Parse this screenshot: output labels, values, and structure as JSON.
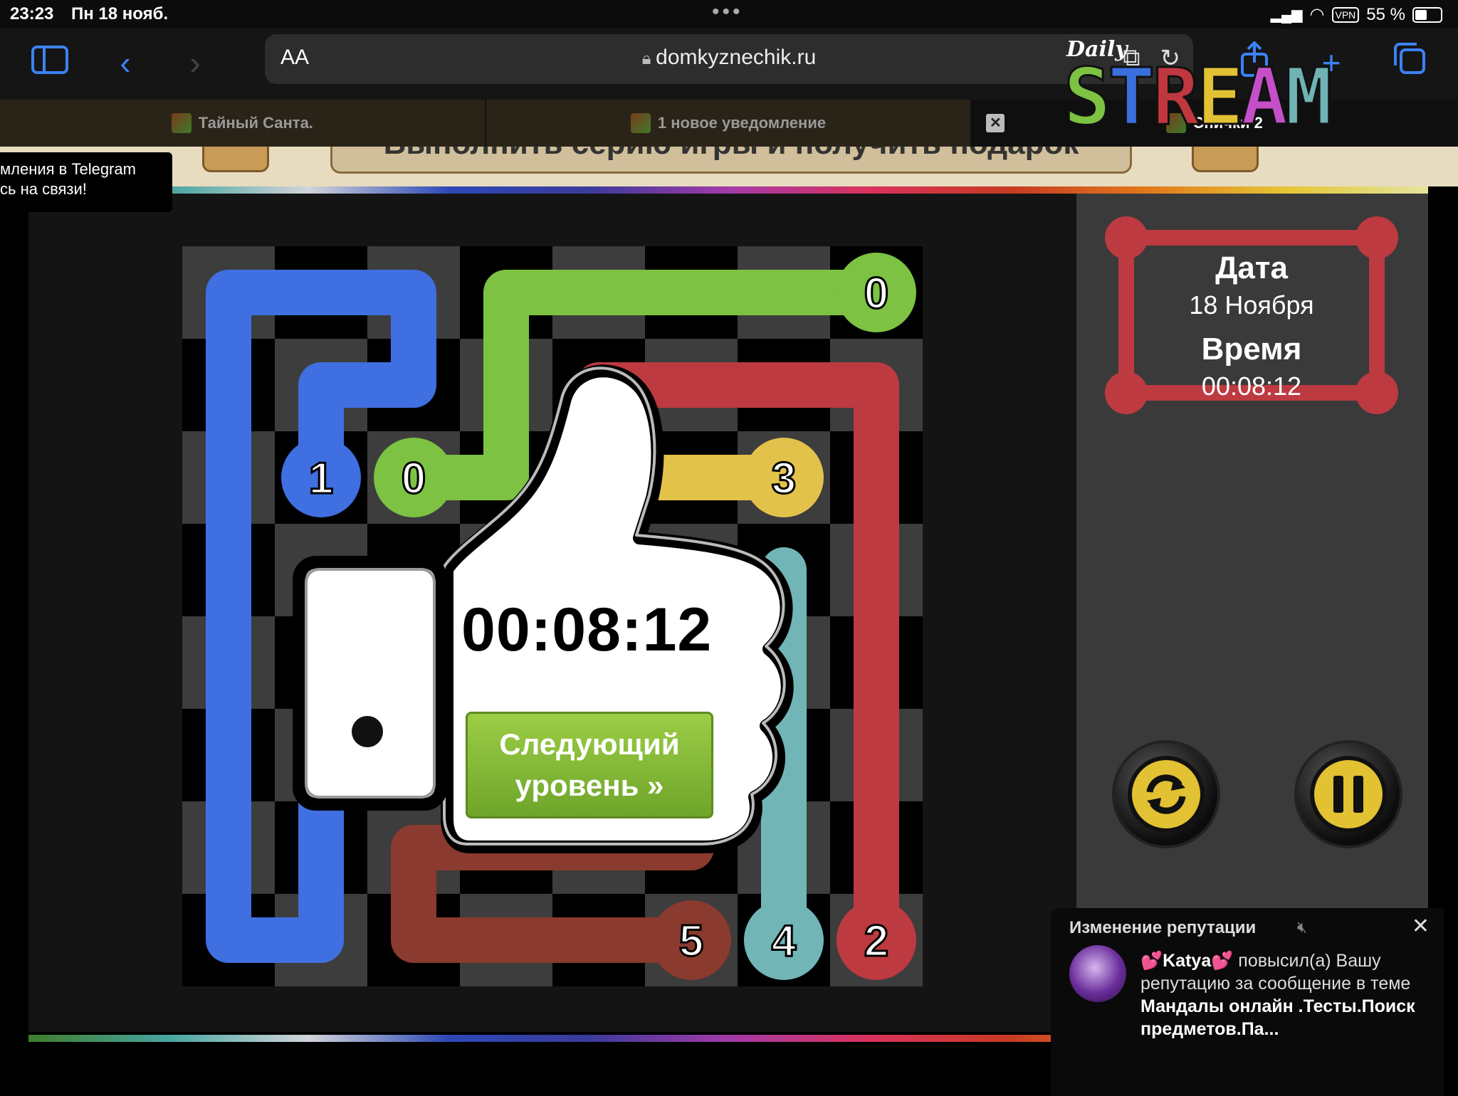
{
  "status_bar": {
    "time": "23:23",
    "date": "Пн 18 нояб.",
    "dots": "•••",
    "vpn": "VPN",
    "battery": "55 %"
  },
  "toolbar": {
    "aa_label": "AA",
    "url": "domkyznechik.ru"
  },
  "tabs": [
    {
      "label": "Тайный Санта.",
      "active": false
    },
    {
      "label": "1 новое уведомление",
      "active": false
    },
    {
      "label": "Спички 2",
      "active": true
    }
  ],
  "site": {
    "banner_text": "Выполнить серию игры и получить подарок",
    "telegram_tip_line1": "мления в Telegram",
    "telegram_tip_line2": "сь на связи!"
  },
  "game": {
    "logo_daily": "Daily",
    "logo_letters": [
      "S",
      "T",
      "R",
      "E",
      "A",
      "M"
    ],
    "logo_colors": [
      "#7dc242",
      "#3b6fe0",
      "#c0373f",
      "#e2c133",
      "#c54fc9",
      "#6fb3b5"
    ],
    "date_label": "Дата",
    "date_value": "18 Ноября",
    "time_label": "Время",
    "time_value": "00:08:12",
    "popup_timer": "00:08:12",
    "next_button": "Следующий уровень »",
    "grid_size": 8,
    "colors": {
      "blue": "#3f6fe0",
      "green": "#7dc242",
      "red": "#bd3a40",
      "yellow": "#e2c24a",
      "teal": "#72b5b7",
      "brown": "#8a3a2e"
    },
    "endpoints": [
      {
        "label": "0",
        "color": "green",
        "col": 7,
        "row": 0
      },
      {
        "label": "1",
        "color": "blue",
        "col": 1,
        "row": 2
      },
      {
        "label": "0",
        "color": "green",
        "col": 2,
        "row": 2
      },
      {
        "label": "3",
        "color": "yellow",
        "col": 6,
        "row": 2
      },
      {
        "label": "5",
        "color": "brown",
        "col": 5,
        "row": 7
      },
      {
        "label": "4",
        "color": "teal",
        "col": 6,
        "row": 7
      },
      {
        "label": "2",
        "color": "red",
        "col": 7,
        "row": 7
      }
    ]
  },
  "notification": {
    "title": "Изменение репутации",
    "user": "💕Katya💕",
    "text_before": " повысил(а) Вашу репутацию за сообщение в теме ",
    "topic": "Мандалы онлайн .Тесты.Поиск предметов.Па..."
  }
}
